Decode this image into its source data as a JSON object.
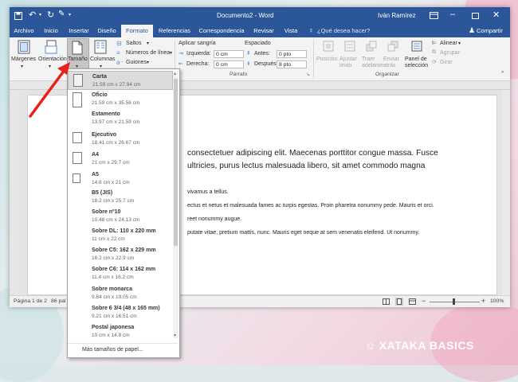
{
  "titlebar": {
    "document_title": "Documento2  -  Word",
    "user": "Iván Ramírez",
    "qat": {
      "save": "save-icon",
      "undo": "undo-icon",
      "redo": "redo-icon",
      "format_painter": "format-painter-icon"
    }
  },
  "tabs": [
    "Archivo",
    "Inicio",
    "Insertar",
    "Diseño",
    "Formato",
    "Referencias",
    "Correspondencia",
    "Revisar",
    "Vista"
  ],
  "tell_me": "¿Qué desea hacer?",
  "share": "Compartir",
  "ribbon": {
    "margins": "Márgenes",
    "orientation": "Orientación",
    "size": "Tamaño",
    "columns": "Columnas",
    "breaks": "Saltos",
    "line_numbers": "Números de línea",
    "hyphenation": "Guiones",
    "indent_title": "Aplicar sangría",
    "spacing_title": "Espaciado",
    "left_label": "Izquierda:",
    "left_value": "0 cm",
    "right_label": "Derecha:",
    "right_value": "0 cm",
    "before_label": "Antes:",
    "before_value": "0 pto",
    "after_label": "Después:",
    "after_value": "8 pto",
    "paragraph_group": "Párrafo",
    "position": "Posición",
    "wrap_text": "Ajustar texto",
    "bring_forward": "Traer adelante",
    "send_backward": "Enviar atrás",
    "selection_pane": "Panel de selección",
    "align": "Alinear",
    "group": "Agrupar",
    "rotate": "Girar",
    "arrange_group": "Organizar"
  },
  "document": {
    "line1": "consectetuer adipiscing elit. Maecenas porttitor congue massa. Fusce",
    "line2": "ultricies, purus lectus malesuada libero, sit amet commodo magna",
    "line3": "vivamus a tellus.",
    "line4": "ectus et netus et malesuada fames ac turpis egestas. Proin pharetra nonummy pede. Mauris et orci.",
    "line5": "reet nonummy augue.",
    "line6": "putate vitae, pretium mattis, nunc. Mauris eget neque at sem venenatis eleifend. Ut nonummy."
  },
  "paper_sizes": [
    {
      "name": "Carta",
      "size": "21.59 cm x 27.94 cm"
    },
    {
      "name": "Oficio",
      "size": "21.59 cm x 35.56 cm"
    },
    {
      "name": "Estamento",
      "size": "13.97 cm x 21.59 cm"
    },
    {
      "name": "Ejecutivo",
      "size": "18.41 cm x 26.67 cm"
    },
    {
      "name": "A4",
      "size": "21 cm x 29.7 cm"
    },
    {
      "name": "A5",
      "size": "14.8 cm x 21 cm"
    },
    {
      "name": "B5 (JIS)",
      "size": "18.2 cm x 25.7 cm"
    },
    {
      "name": "Sobre nº10",
      "size": "10.48 cm x 24.13 cm"
    },
    {
      "name": "Sobre DL: 110 x 220 mm",
      "size": "11 cm x 22 cm"
    },
    {
      "name": "Sobre C5: 162 x 229 mm",
      "size": "16.2 cm x 22.9 cm"
    },
    {
      "name": "Sobre C6: 114 x 162 mm",
      "size": "11.4 cm x 16.2 cm"
    },
    {
      "name": "Sobre monarca",
      "size": "9.84 cm x 19.05 cm"
    },
    {
      "name": "Sobre 6 3/4 (48 x 165 mm)",
      "size": "9.21 cm x 16.51 cm"
    },
    {
      "name": "Postal japonesa",
      "size": "10 cm x 14.8 cm"
    }
  ],
  "more_sizes": "Más tamaños de papel...",
  "status": {
    "page": "Página 1 de 2",
    "words": "86 pal",
    "zoom": "100%"
  },
  "watermark": "XATAKA BASICS",
  "colors": {
    "word_blue": "#2b579a",
    "arrow_red": "#e8211b"
  }
}
